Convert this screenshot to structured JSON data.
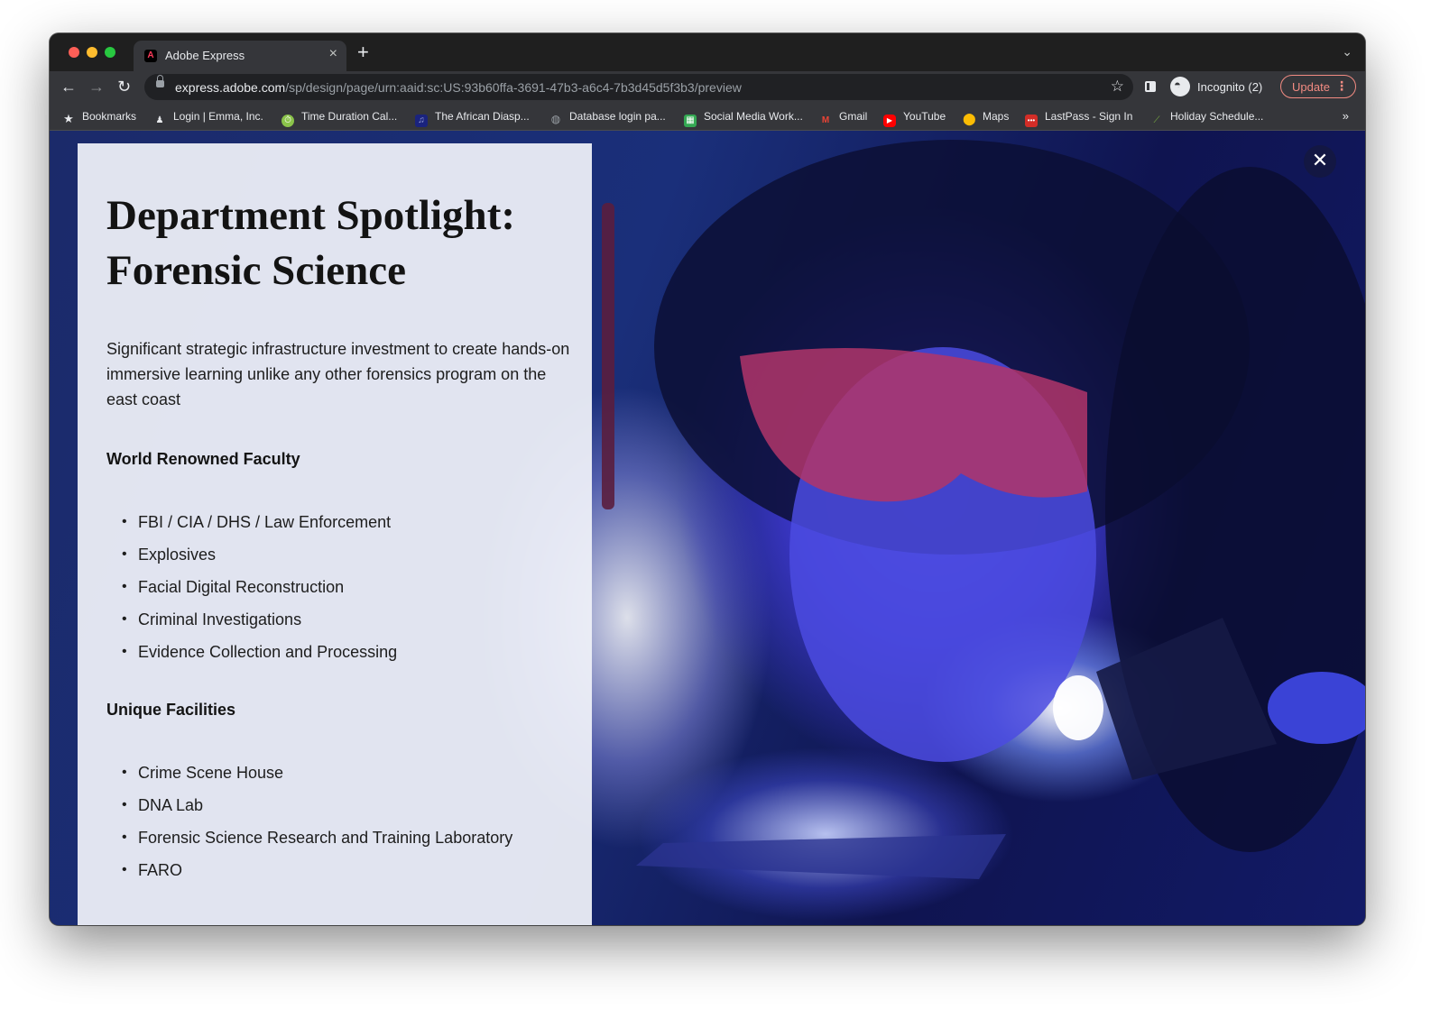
{
  "browser": {
    "tab_title": "Adobe Express",
    "url_host": "express.adobe.com",
    "url_path": "/sp/design/page/urn:aaid:sc:US:93b60ffa-3691-47b3-a6c4-7b3d45d5f3b3/preview",
    "incognito_label": "Incognito (2)",
    "update_label": "Update"
  },
  "bookmarks": [
    {
      "label": "Bookmarks",
      "icon": "star-icon",
      "color": "#e8eaed"
    },
    {
      "label": "Login | Emma, Inc.",
      "icon": "person-icon",
      "color": "#e8eaed"
    },
    {
      "label": "Time Duration Cal...",
      "icon": "clock-icon",
      "color": "#8bc34a"
    },
    {
      "label": "The African Diasp...",
      "icon": "music-icon",
      "color": "#3f51b5"
    },
    {
      "label": "Database login pa...",
      "icon": "globe-icon",
      "color": "#9aa0a6"
    },
    {
      "label": "Social Media Work...",
      "icon": "sheets-icon",
      "color": "#34a853"
    },
    {
      "label": "Gmail",
      "icon": "gmail-icon",
      "color": "#ea4335"
    },
    {
      "label": "YouTube",
      "icon": "youtube-icon",
      "color": "#ff0000"
    },
    {
      "label": "Maps",
      "icon": "map-pin-icon",
      "color": "#fbbc04"
    },
    {
      "label": "LastPass - Sign In",
      "icon": "lastpass-icon",
      "color": "#d32d27"
    },
    {
      "label": "Holiday Schedule...",
      "icon": "leaf-icon",
      "color": "#7cb342"
    }
  ],
  "card": {
    "title": "Department Spotlight: Forensic Science",
    "intro": "Significant strategic infrastructure investment to create hands-on immersive learning unlike any other forensics program on the east coast",
    "section1_heading": "World Renowned Faculty",
    "section1_items": [
      "FBI / CIA / DHS / Law Enforcement",
      "Explosives",
      "Facial Digital Reconstruction",
      "Criminal Investigations",
      "Evidence Collection and Processing"
    ],
    "section2_heading": "Unique Facilities",
    "section2_items": [
      "Crime Scene House",
      "DNA Lab",
      "Forensic Science Research and Training Laboratory",
      "FARO"
    ]
  },
  "colors": {
    "accent_update": "#f28b82",
    "tab_bg": "#35363a",
    "frame_bg": "#1f1f1f"
  }
}
